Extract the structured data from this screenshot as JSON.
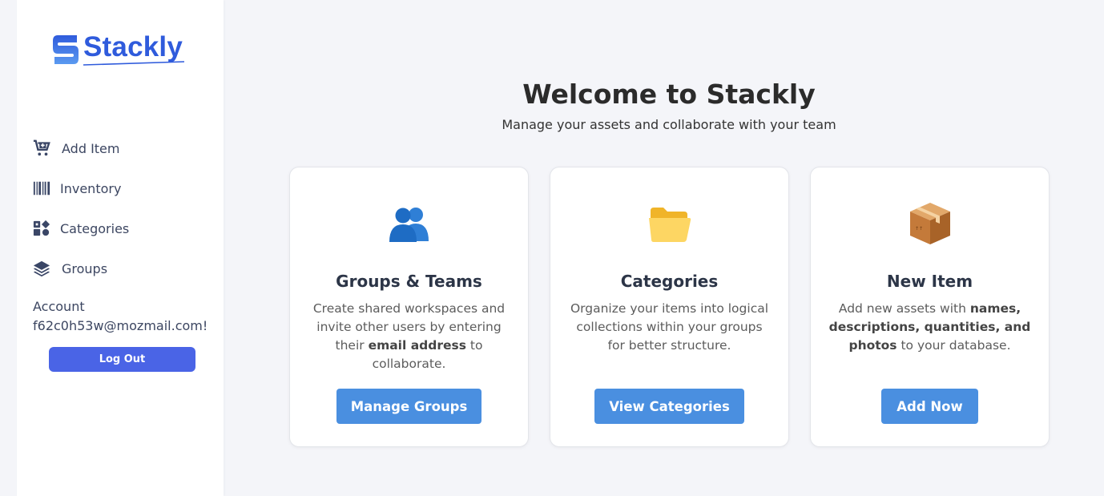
{
  "brand": {
    "name": "Stackly",
    "color": "#2f5bdc"
  },
  "sidebar": {
    "items": [
      {
        "label": "Add Item",
        "icon": "cart-plus-icon"
      },
      {
        "label": "Inventory",
        "icon": "barcode-icon"
      },
      {
        "label": "Categories",
        "icon": "categories-icon"
      },
      {
        "label": "Groups",
        "icon": "layers-icon"
      }
    ],
    "account_label": "Account",
    "account_email": "f62c0h53w@mozmail.com!",
    "logout_label": "Log Out"
  },
  "main": {
    "title": "Welcome to Stackly",
    "subtitle": "Manage your assets and collaborate with your team",
    "cards": [
      {
        "icon": "people-icon",
        "title": "Groups & Teams",
        "text_parts": [
          "Create shared workspaces and invite other users by entering their ",
          "email address",
          " to collaborate."
        ],
        "button": "Manage Groups"
      },
      {
        "icon": "folder-icon",
        "title": "Categories",
        "text_parts": [
          "Organize your items into logical collections within your groups for better structure."
        ],
        "button": "View Categories"
      },
      {
        "icon": "package-icon",
        "title": "New Item",
        "text_parts": [
          "Add new assets with ",
          "names, descriptions, quantities, and photos",
          " to your database."
        ],
        "button": "Add Now"
      }
    ]
  },
  "colors": {
    "accent_button": "#4a8fe0",
    "logout_button": "#4a64e6",
    "background": "#f4f5f9"
  }
}
